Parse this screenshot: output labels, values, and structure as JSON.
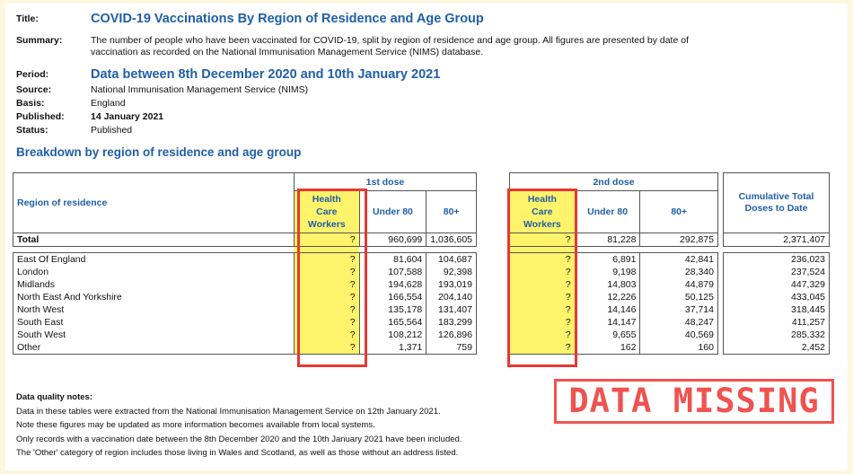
{
  "meta": {
    "title_key": "Title:",
    "title": "COVID-19 Vaccinations By Region of Residence and Age Group",
    "summary_key": "Summary:",
    "summary_line1": "The number of people who have been vaccinated for COVID-19, split by region of residence and age group. All figures are presented by date of",
    "summary_line2": "vaccination as recorded on the National Immunisation Management Service (NIMS) database.",
    "period_key": "Period:",
    "period": "Data between 8th December 2020 and 10th January 2021",
    "source_key": "Source:",
    "source": "National Immunisation Management Service (NIMS)",
    "basis_key": "Basis:",
    "basis": "England",
    "published_key": "Published:",
    "published": "14 January 2021",
    "status_key": "Status:",
    "status": "Published"
  },
  "section_title": "Breakdown by region of residence and age group",
  "table": {
    "region_header": "Region of residence",
    "dose1_header": "1st dose",
    "dose2_header": "2nd dose",
    "hcw_line1": "Health",
    "hcw_line2": "Care",
    "hcw_line3": "Workers",
    "under80_header": "Under 80",
    "over80_header": "80+",
    "cumulative_line1": "Cumulative Total",
    "cumulative_line2": "Doses to Date",
    "total": {
      "region": "Total",
      "d1_hcw": "?",
      "d1_u80": "960,699",
      "d1_80": "1,036,605",
      "d2_hcw": "?",
      "d2_u80": "81,228",
      "d2_80": "292,875",
      "cum": "2,371,407"
    },
    "rows": [
      {
        "region": "East Of England",
        "d1_hcw": "?",
        "d1_u80": "81,604",
        "d1_80": "104,687",
        "d2_hcw": "?",
        "d2_u80": "6,891",
        "d2_80": "42,841",
        "cum": "236,023"
      },
      {
        "region": "London",
        "d1_hcw": "?",
        "d1_u80": "107,588",
        "d1_80": "92,398",
        "d2_hcw": "?",
        "d2_u80": "9,198",
        "d2_80": "28,340",
        "cum": "237,524"
      },
      {
        "region": "Midlands",
        "d1_hcw": "?",
        "d1_u80": "194,628",
        "d1_80": "193,019",
        "d2_hcw": "?",
        "d2_u80": "14,803",
        "d2_80": "44,879",
        "cum": "447,329"
      },
      {
        "region": "North East And Yorkshire",
        "d1_hcw": "?",
        "d1_u80": "166,554",
        "d1_80": "204,140",
        "d2_hcw": "?",
        "d2_u80": "12,226",
        "d2_80": "50,125",
        "cum": "433,045"
      },
      {
        "region": "North West",
        "d1_hcw": "?",
        "d1_u80": "135,178",
        "d1_80": "131,407",
        "d2_hcw": "?",
        "d2_u80": "14,146",
        "d2_80": "37,714",
        "cum": "318,445"
      },
      {
        "region": "South East",
        "d1_hcw": "?",
        "d1_u80": "165,564",
        "d1_80": "183,299",
        "d2_hcw": "?",
        "d2_u80": "14,147",
        "d2_80": "48,247",
        "cum": "411,257"
      },
      {
        "region": "South West",
        "d1_hcw": "?",
        "d1_u80": "108,212",
        "d1_80": "126,896",
        "d2_hcw": "?",
        "d2_u80": "9,655",
        "d2_80": "40,569",
        "cum": "285,332"
      },
      {
        "region": "Other",
        "d1_hcw": "?",
        "d1_u80": "1,371",
        "d1_80": "759",
        "d2_hcw": "?",
        "d2_u80": "162",
        "d2_80": "160",
        "cum": "2,452"
      }
    ]
  },
  "notes": {
    "heading": "Data quality notes:",
    "lines": [
      "Data in these tables were extracted from the National Immunisation Management Service on 12th January 2021.",
      "Note these figures may be updated as more information becomes available from local systems.",
      "Only records with a vaccination date between the 8th December 2020 and the 10th January 2021 have been included.",
      "The 'Other' category of region includes those living in Wales and Scotland, as well as those without an address listed."
    ]
  },
  "stamp": "DATA MISSING",
  "colors": {
    "title_blue": "#1f5fa7",
    "highlight_yellow": "#fff36b",
    "annotation_red": "#e53935",
    "page_border": "#fdf7df"
  }
}
